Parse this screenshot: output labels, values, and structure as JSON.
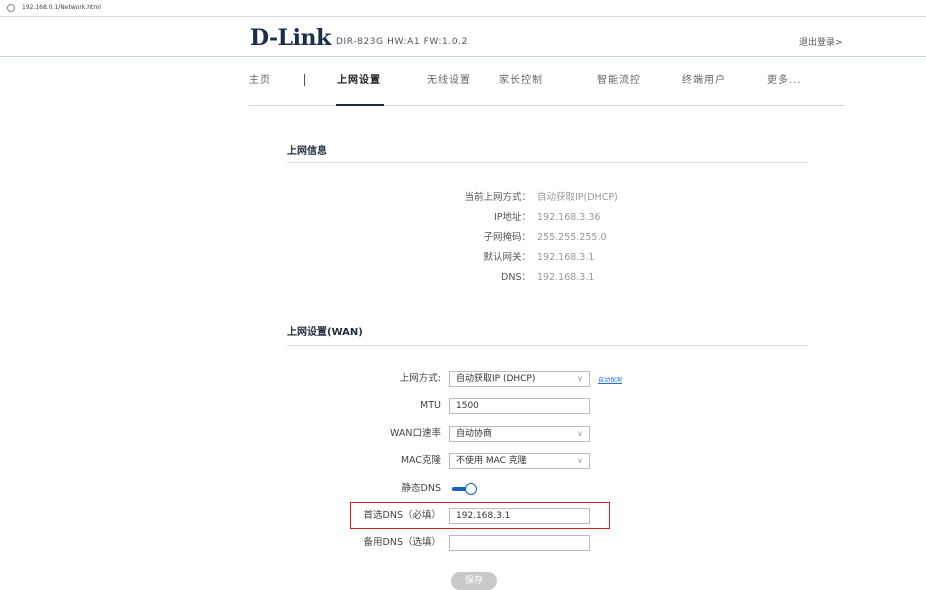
{
  "address_bar": {
    "url": "192.168.0.1/Network.html",
    "icon": "info-icon"
  },
  "header": {
    "logo": "D-Link",
    "model_info": "DIR-823G  HW:A1  FW:1.0.2",
    "logout": "退出登录>"
  },
  "nav": {
    "items": [
      {
        "label": "主页",
        "active": false
      },
      {
        "label": "上网设置",
        "active": true
      },
      {
        "label": "无线设置",
        "active": false
      },
      {
        "label": "家长控制",
        "active": false
      },
      {
        "label": "智能流控",
        "active": false
      },
      {
        "label": "终端用户",
        "active": false
      },
      {
        "label": "更多...",
        "active": false
      }
    ],
    "separator": "|"
  },
  "internet_info": {
    "title": "上网信息",
    "rows": [
      {
        "label": "当前上网方式：",
        "value": "自动获取IP(DHCP)"
      },
      {
        "label": "IP地址：",
        "value": "192.168.3.36"
      },
      {
        "label": "子网掩码：",
        "value": "255.255.255.0"
      },
      {
        "label": "默认网关：",
        "value": "192.168.3.1"
      },
      {
        "label": "DNS：",
        "value": "192.168.3.1"
      }
    ]
  },
  "wan_settings": {
    "title": "上网设置(WAN)",
    "connection_type": {
      "label": "上网方式:",
      "value": "自动获取IP (DHCP)",
      "link": "自动探测"
    },
    "mtu": {
      "label": "MTU",
      "value": "1500"
    },
    "wan_speed": {
      "label": "WAN口速率",
      "value": "自动协商"
    },
    "mac_clone": {
      "label": "MAC克隆",
      "value": "不使用 MAC 克隆"
    },
    "static_dns": {
      "label": "静态DNS",
      "enabled": true
    },
    "primary_dns": {
      "label": "首选DNS（必填）",
      "value": "192.168.3.1"
    },
    "secondary_dns": {
      "label": "备用DNS（选填）",
      "value": ""
    },
    "save_label": "保存",
    "colors": {
      "accent": "#1565c0",
      "highlight": "#e01b1b",
      "link": "#2d6fd6"
    }
  }
}
